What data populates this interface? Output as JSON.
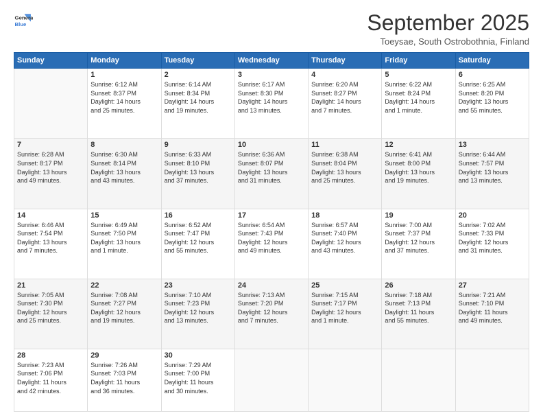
{
  "logo": {
    "line1": "General",
    "line2": "Blue"
  },
  "title": "September 2025",
  "subtitle": "Toeysae, South Ostrobothnia, Finland",
  "weekdays": [
    "Sunday",
    "Monday",
    "Tuesday",
    "Wednesday",
    "Thursday",
    "Friday",
    "Saturday"
  ],
  "weeks": [
    [
      {
        "day": "",
        "sunrise": "",
        "sunset": "",
        "daylight": ""
      },
      {
        "day": "1",
        "sunrise": "Sunrise: 6:12 AM",
        "sunset": "Sunset: 8:37 PM",
        "daylight": "Daylight: 14 hours and 25 minutes."
      },
      {
        "day": "2",
        "sunrise": "Sunrise: 6:14 AM",
        "sunset": "Sunset: 8:34 PM",
        "daylight": "Daylight: 14 hours and 19 minutes."
      },
      {
        "day": "3",
        "sunrise": "Sunrise: 6:17 AM",
        "sunset": "Sunset: 8:30 PM",
        "daylight": "Daylight: 14 hours and 13 minutes."
      },
      {
        "day": "4",
        "sunrise": "Sunrise: 6:20 AM",
        "sunset": "Sunset: 8:27 PM",
        "daylight": "Daylight: 14 hours and 7 minutes."
      },
      {
        "day": "5",
        "sunrise": "Sunrise: 6:22 AM",
        "sunset": "Sunset: 8:24 PM",
        "daylight": "Daylight: 14 hours and 1 minute."
      },
      {
        "day": "6",
        "sunrise": "Sunrise: 6:25 AM",
        "sunset": "Sunset: 8:20 PM",
        "daylight": "Daylight: 13 hours and 55 minutes."
      }
    ],
    [
      {
        "day": "7",
        "sunrise": "Sunrise: 6:28 AM",
        "sunset": "Sunset: 8:17 PM",
        "daylight": "Daylight: 13 hours and 49 minutes."
      },
      {
        "day": "8",
        "sunrise": "Sunrise: 6:30 AM",
        "sunset": "Sunset: 8:14 PM",
        "daylight": "Daylight: 13 hours and 43 minutes."
      },
      {
        "day": "9",
        "sunrise": "Sunrise: 6:33 AM",
        "sunset": "Sunset: 8:10 PM",
        "daylight": "Daylight: 13 hours and 37 minutes."
      },
      {
        "day": "10",
        "sunrise": "Sunrise: 6:36 AM",
        "sunset": "Sunset: 8:07 PM",
        "daylight": "Daylight: 13 hours and 31 minutes."
      },
      {
        "day": "11",
        "sunrise": "Sunrise: 6:38 AM",
        "sunset": "Sunset: 8:04 PM",
        "daylight": "Daylight: 13 hours and 25 minutes."
      },
      {
        "day": "12",
        "sunrise": "Sunrise: 6:41 AM",
        "sunset": "Sunset: 8:00 PM",
        "daylight": "Daylight: 13 hours and 19 minutes."
      },
      {
        "day": "13",
        "sunrise": "Sunrise: 6:44 AM",
        "sunset": "Sunset: 7:57 PM",
        "daylight": "Daylight: 13 hours and 13 minutes."
      }
    ],
    [
      {
        "day": "14",
        "sunrise": "Sunrise: 6:46 AM",
        "sunset": "Sunset: 7:54 PM",
        "daylight": "Daylight: 13 hours and 7 minutes."
      },
      {
        "day": "15",
        "sunrise": "Sunrise: 6:49 AM",
        "sunset": "Sunset: 7:50 PM",
        "daylight": "Daylight: 13 hours and 1 minute."
      },
      {
        "day": "16",
        "sunrise": "Sunrise: 6:52 AM",
        "sunset": "Sunset: 7:47 PM",
        "daylight": "Daylight: 12 hours and 55 minutes."
      },
      {
        "day": "17",
        "sunrise": "Sunrise: 6:54 AM",
        "sunset": "Sunset: 7:43 PM",
        "daylight": "Daylight: 12 hours and 49 minutes."
      },
      {
        "day": "18",
        "sunrise": "Sunrise: 6:57 AM",
        "sunset": "Sunset: 7:40 PM",
        "daylight": "Daylight: 12 hours and 43 minutes."
      },
      {
        "day": "19",
        "sunrise": "Sunrise: 7:00 AM",
        "sunset": "Sunset: 7:37 PM",
        "daylight": "Daylight: 12 hours and 37 minutes."
      },
      {
        "day": "20",
        "sunrise": "Sunrise: 7:02 AM",
        "sunset": "Sunset: 7:33 PM",
        "daylight": "Daylight: 12 hours and 31 minutes."
      }
    ],
    [
      {
        "day": "21",
        "sunrise": "Sunrise: 7:05 AM",
        "sunset": "Sunset: 7:30 PM",
        "daylight": "Daylight: 12 hours and 25 minutes."
      },
      {
        "day": "22",
        "sunrise": "Sunrise: 7:08 AM",
        "sunset": "Sunset: 7:27 PM",
        "daylight": "Daylight: 12 hours and 19 minutes."
      },
      {
        "day": "23",
        "sunrise": "Sunrise: 7:10 AM",
        "sunset": "Sunset: 7:23 PM",
        "daylight": "Daylight: 12 hours and 13 minutes."
      },
      {
        "day": "24",
        "sunrise": "Sunrise: 7:13 AM",
        "sunset": "Sunset: 7:20 PM",
        "daylight": "Daylight: 12 hours and 7 minutes."
      },
      {
        "day": "25",
        "sunrise": "Sunrise: 7:15 AM",
        "sunset": "Sunset: 7:17 PM",
        "daylight": "Daylight: 12 hours and 1 minute."
      },
      {
        "day": "26",
        "sunrise": "Sunrise: 7:18 AM",
        "sunset": "Sunset: 7:13 PM",
        "daylight": "Daylight: 11 hours and 55 minutes."
      },
      {
        "day": "27",
        "sunrise": "Sunrise: 7:21 AM",
        "sunset": "Sunset: 7:10 PM",
        "daylight": "Daylight: 11 hours and 49 minutes."
      }
    ],
    [
      {
        "day": "28",
        "sunrise": "Sunrise: 7:23 AM",
        "sunset": "Sunset: 7:06 PM",
        "daylight": "Daylight: 11 hours and 42 minutes."
      },
      {
        "day": "29",
        "sunrise": "Sunrise: 7:26 AM",
        "sunset": "Sunset: 7:03 PM",
        "daylight": "Daylight: 11 hours and 36 minutes."
      },
      {
        "day": "30",
        "sunrise": "Sunrise: 7:29 AM",
        "sunset": "Sunset: 7:00 PM",
        "daylight": "Daylight: 11 hours and 30 minutes."
      },
      {
        "day": "",
        "sunrise": "",
        "sunset": "",
        "daylight": ""
      },
      {
        "day": "",
        "sunrise": "",
        "sunset": "",
        "daylight": ""
      },
      {
        "day": "",
        "sunrise": "",
        "sunset": "",
        "daylight": ""
      },
      {
        "day": "",
        "sunrise": "",
        "sunset": "",
        "daylight": ""
      }
    ]
  ]
}
